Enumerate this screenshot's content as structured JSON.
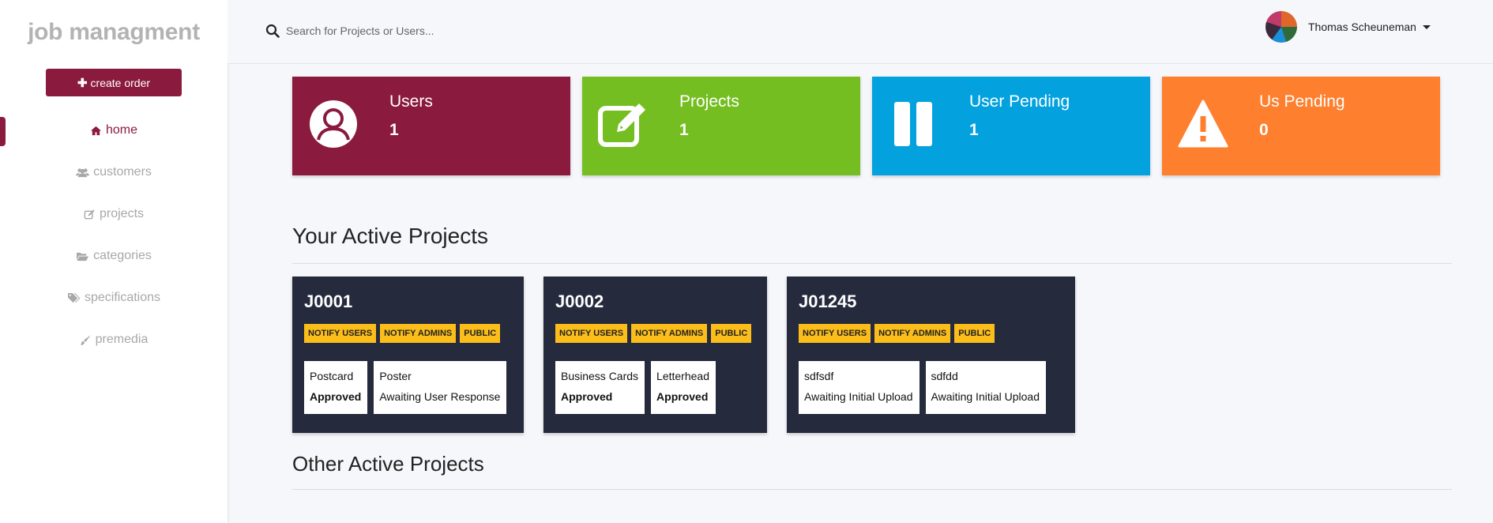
{
  "sidebar": {
    "brand": "job managment",
    "create_label": "create order",
    "nav": [
      {
        "label": "home",
        "icon": "home-icon",
        "active": true
      },
      {
        "label": "customers",
        "icon": "users-icon"
      },
      {
        "label": "projects",
        "icon": "edit-icon"
      },
      {
        "label": "categories",
        "icon": "folder-open-icon"
      },
      {
        "label": "specifications",
        "icon": "tags-icon"
      },
      {
        "label": "premedia",
        "icon": "paint-brush-icon"
      }
    ]
  },
  "header": {
    "search_placeholder": "Search for Projects or Users...",
    "user_name": "Thomas Scheuneman"
  },
  "stats": [
    {
      "label": "Users",
      "value": "1",
      "color": "#8b1a3f",
      "icon": "user-circle-icon"
    },
    {
      "label": "Projects",
      "value": "1",
      "color": "#75be22",
      "icon": "edit-icon"
    },
    {
      "label": "User Pending",
      "value": "1",
      "color": "#03a2df",
      "icon": "pause-icon"
    },
    {
      "label": "Us Pending",
      "value": "0",
      "color": "#fe7f2e",
      "icon": "warning-icon"
    }
  ],
  "sections": {
    "active_title": "Your Active Projects",
    "other_title": "Other Active Projects"
  },
  "projects": [
    {
      "code": "J0001",
      "tags": [
        "NOTIFY USERS",
        "NOTIFY ADMINS",
        "PUBLIC"
      ],
      "items": [
        {
          "name": "Postcard",
          "status": "Approved"
        },
        {
          "name": "Poster",
          "status": "Awaiting User Response"
        }
      ]
    },
    {
      "code": "J0002",
      "tags": [
        "NOTIFY USERS",
        "NOTIFY ADMINS",
        "PUBLIC"
      ],
      "items": [
        {
          "name": "Business Cards",
          "status": "Approved"
        },
        {
          "name": "Letterhead",
          "status": "Approved"
        }
      ]
    },
    {
      "code": "J01245",
      "tags": [
        "NOTIFY USERS",
        "NOTIFY ADMINS",
        "PUBLIC"
      ],
      "items": [
        {
          "name": "sdfsdf",
          "status": "Awaiting Initial Upload"
        },
        {
          "name": "sdfdd",
          "status": "Awaiting Initial Upload"
        }
      ]
    }
  ],
  "colors": {
    "accent": "#8b1a3f",
    "tag": "#fbbd1a",
    "project_card": "#262a3d"
  }
}
